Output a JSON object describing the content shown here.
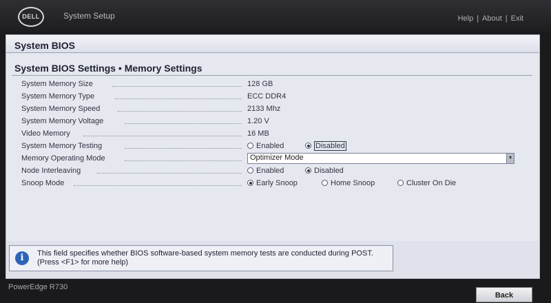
{
  "header": {
    "logo_text": "DELL",
    "title": "System Setup",
    "nav": {
      "help": "Help",
      "about": "About",
      "exit": "Exit",
      "separator": "|"
    }
  },
  "panel": {
    "title": "System BIOS",
    "subtitle": "System BIOS Settings • Memory Settings"
  },
  "settings": [
    {
      "label": "System Memory Size",
      "value": "128 GB"
    },
    {
      "label": "System Memory Type",
      "value": "ECC DDR4"
    },
    {
      "label": "System Memory Speed",
      "value": "2133 Mhz"
    },
    {
      "label": "System Memory Voltage",
      "value": "1.20 V"
    },
    {
      "label": "Video Memory",
      "value": "16 MB"
    },
    {
      "label": "System Memory Testing",
      "options": [
        "Enabled",
        "Disabled"
      ],
      "selected": "Disabled"
    },
    {
      "label": "Memory Operating Mode",
      "select_value": "Optimizer Mode"
    },
    {
      "label": "Node Interleaving",
      "options": [
        "Enabled",
        "Disabled"
      ],
      "selected": "Disabled"
    },
    {
      "label": "Snoop Mode",
      "options": [
        "Early Snoop",
        "Home Snoop",
        "Cluster On Die"
      ],
      "selected": "Early Snoop"
    }
  ],
  "help": {
    "icon": "info-icon",
    "text": "This field specifies whether BIOS software-based system memory tests are conducted during POST. (Press <F1> for more help)"
  },
  "footer": {
    "model": "PowerEdge R730",
    "back_label": "Back"
  },
  "colors": {
    "panel_bg": "#e6e8f0",
    "topbar_bg": "#1e1e21",
    "info_blue": "#2c64b8"
  }
}
